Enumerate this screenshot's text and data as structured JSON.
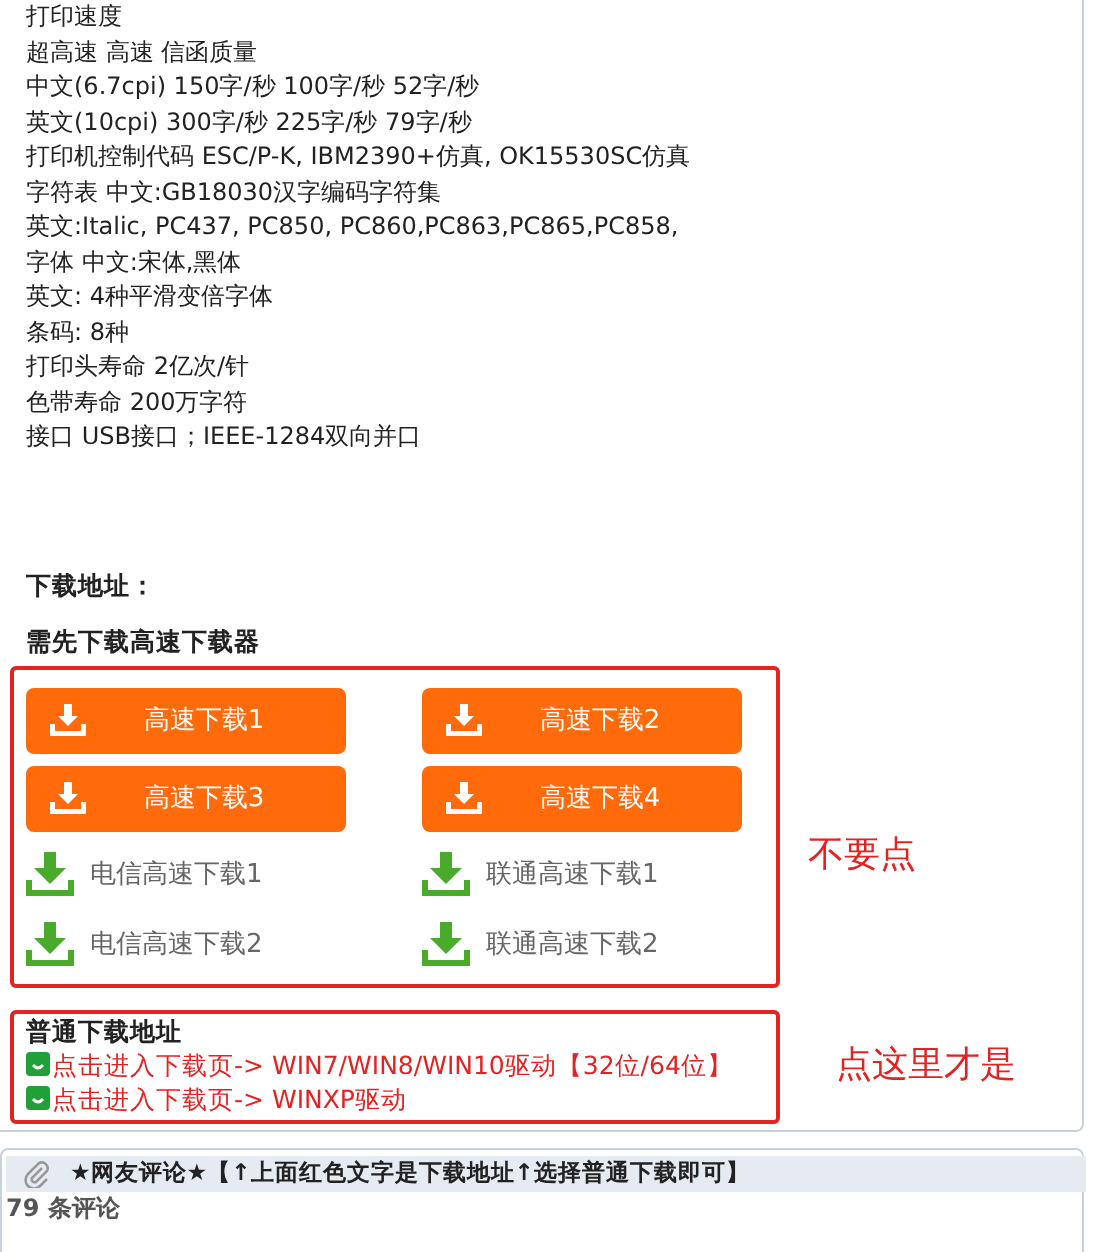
{
  "specs": [
    "打印速度",
    "超高速 高速 信函质量",
    "中文(6.7cpi) 150字/秒 100字/秒 52字/秒",
    "英文(10cpi) 300字/秒 225字/秒 79字/秒",
    "打印机控制代码 ESC/P-K, IBM2390+仿真, OK15530SC仿真",
    "字符表 中文:GB18030汉字编码字符集",
    "英文:Italic, PC437, PC850, PC860,PC863,PC865,PC858,",
    "字体 中文:宋体,黑体",
    "英文: 4种平滑变倍字体",
    "条码: 8种",
    "打印头寿命 2亿次/针",
    "色带寿命 200万字符",
    "接口 USB接口；IEEE-1284双向并口"
  ],
  "download_heading": "下载地址：",
  "fast_section": {
    "heading": "需先下载高速下载器",
    "note": "不要点",
    "buttons": [
      {
        "kind": "orange",
        "label": "高速下载1"
      },
      {
        "kind": "orange",
        "label": "高速下载2"
      },
      {
        "kind": "orange",
        "label": "高速下载3"
      },
      {
        "kind": "orange",
        "label": "高速下载4"
      },
      {
        "kind": "green",
        "label": "电信高速下载1"
      },
      {
        "kind": "green",
        "label": "联通高速下载1"
      },
      {
        "kind": "green",
        "label": "电信高速下载2"
      },
      {
        "kind": "green",
        "label": "联通高速下载2"
      }
    ]
  },
  "normal_section": {
    "heading": "普通下载地址",
    "note": "点这里才是",
    "links": [
      "点击进入下载页-> WIN7/WIN8/WIN10驱动【32位/64位】",
      "点击进入下载页-> WINXP驱动"
    ]
  },
  "comments": {
    "title": "★网友评论★【↑上面红色文字是下载地址↑选择普通下载即可】",
    "count": "79 条评论"
  }
}
